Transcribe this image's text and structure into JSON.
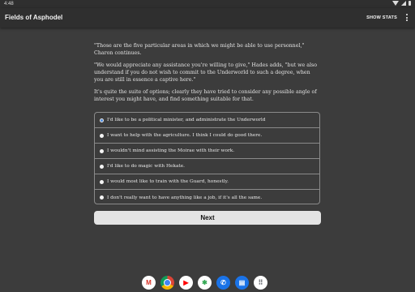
{
  "status_bar": {
    "time": "4:48"
  },
  "app_bar": {
    "title": "Fields of Asphodel",
    "show_stats_label": "SHOW STATS"
  },
  "story": {
    "paragraphs": [
      "\"Those are the five particular areas in which we might be able to use personnel,\" Charon continues.",
      "\"We would appreciate any assistance you're willing to give,\" Hades adds, \"but we also understand if you do not wish to commit to the Underworld to such a degree, when you are still in essence a captive here.\"",
      "It's quite the suite of options; clearly they have tried to consider any possible angle of interest you might have, and find something suitable for that."
    ]
  },
  "choices": [
    {
      "label": "I'd like to be a political minister, and administrate the Underworld",
      "selected": true
    },
    {
      "label": "I want to help with the agriculture. I think I could do good there.",
      "selected": false
    },
    {
      "label": "I wouldn't mind assisting the Moirae with their work.",
      "selected": false
    },
    {
      "label": "I'd like to do magic with Hekate.",
      "selected": false
    },
    {
      "label": "I would most like to train with the Guard, honestly.",
      "selected": false
    },
    {
      "label": "I don't really want to have anything like a job, if it's all the same.",
      "selected": false
    }
  ],
  "next_button": {
    "label": "Next"
  },
  "dock": {
    "apps": [
      {
        "name": "gmail-icon",
        "glyph": "M",
        "bg": "#ffffff",
        "fg": "#d93025"
      },
      {
        "name": "chrome-icon",
        "glyph": "",
        "bg": "#ffffff",
        "fg": "#1a73e8"
      },
      {
        "name": "youtube-icon",
        "glyph": "▶",
        "bg": "#ffffff",
        "fg": "#ff0000"
      },
      {
        "name": "photos-icon",
        "glyph": "✱",
        "bg": "#ffffff",
        "fg": "#34a853"
      },
      {
        "name": "phone-icon",
        "glyph": "✆",
        "bg": "#1a73e8",
        "fg": "#ffffff"
      },
      {
        "name": "messages-icon",
        "glyph": "▤",
        "bg": "#1a73e8",
        "fg": "#ffffff"
      },
      {
        "name": "app-drawer-icon",
        "glyph": "⠿",
        "bg": "#ffffff",
        "fg": "#5f6368"
      }
    ]
  },
  "colors": {
    "background": "#3c3c3c",
    "app_bar": "#2f2f2f",
    "selected_radio": "#4d8be0",
    "button": "#e4e4e4"
  }
}
